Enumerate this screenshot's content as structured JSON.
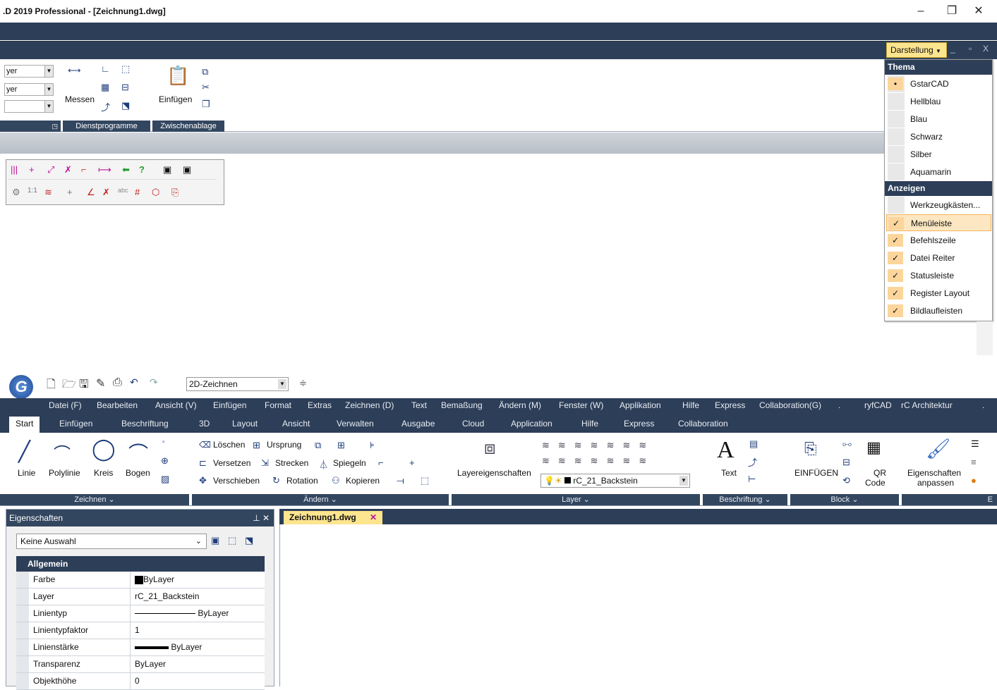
{
  "window": {
    "title": ".D 2019 Professional - [Zeichnung1.dwg]",
    "min": "–",
    "max": "❐",
    "close": "✕"
  },
  "upper_ribbon": {
    "layer_fields": [
      "yer",
      "yer",
      ""
    ],
    "measure_label": "Messen",
    "insert_label": "Einfügen",
    "panels": [
      "Dienstprogramme",
      "Zwischenablage"
    ]
  },
  "darstellung": {
    "button": "Darstellung",
    "ctl": [
      "_",
      "▫",
      "X"
    ]
  },
  "dropdown": {
    "theme_header": "Thema",
    "themes": [
      "GstarCAD",
      "Hellblau",
      "Blau",
      "Schwarz",
      "Silber",
      "Aquamarin"
    ],
    "selected_theme": "GstarCAD",
    "show_header": "Anzeigen",
    "show_items": [
      {
        "label": "Werkzeugkästen...",
        "checked": false
      },
      {
        "label": "Menüleiste",
        "checked": true,
        "highlight": true
      },
      {
        "label": "Befehlszeile",
        "checked": true
      },
      {
        "label": "Datei Reiter",
        "checked": true
      },
      {
        "label": "Statusleiste",
        "checked": true
      },
      {
        "label": "Register Layout",
        "checked": true
      },
      {
        "label": "Bildlaufleisten",
        "checked": true
      }
    ]
  },
  "qat": {
    "workspace": "2D-Zeichnen"
  },
  "menubar": [
    "Datei (F)",
    "Bearbeiten",
    "Ansicht (V)",
    "Einfügen",
    "Format",
    "Extras",
    "Zeichnen (D)",
    "Text",
    "Bemaßung",
    "Ändern (M)",
    "Fenster (W)",
    "Applikation",
    "Hilfe",
    "Express",
    "Collaboration(G)",
    ".",
    "ryfCAD",
    "rC Architektur",
    "."
  ],
  "tabs": [
    "Start",
    "Einfügen",
    "Beschriftung",
    "3D",
    "Layout",
    "Ansicht",
    "Verwalten",
    "Ausgabe",
    "Cloud",
    "Application",
    "Hilfe",
    "Express",
    "Collaboration"
  ],
  "ribbon": {
    "draw": [
      "Linie",
      "Polylinie",
      "Kreis",
      "Bogen"
    ],
    "draw_group": "Zeichnen",
    "modify": [
      "Löschen",
      "Ursprung",
      "Versetzen",
      "Strecken",
      "Spiegeln",
      "Verschieben",
      "Rotation",
      "Kopieren"
    ],
    "modify_group": "Ändern",
    "layer_props": "Layereigenschaften",
    "layer_current": "rC_21_Backstein",
    "layer_group": "Layer",
    "text": "Text",
    "annot_group": "Beschriftung",
    "insert": "EINFÜGEN",
    "qr": "QR",
    "qr2": "Code",
    "block_group": "Block",
    "props_match": "Eigenschaften",
    "props_match2": "anpassen",
    "last_group": "E"
  },
  "properties": {
    "title": "Eigenschaften",
    "pin": "⊥ ✕",
    "selection": "Keine Auswahl",
    "category": "Allgemein",
    "rows": [
      {
        "k": "Farbe",
        "v": "ByLayer"
      },
      {
        "k": "Layer",
        "v": "rC_21_Backstein"
      },
      {
        "k": "Linientyp",
        "v": "ByLayer"
      },
      {
        "k": "Linientypfaktor",
        "v": "1"
      },
      {
        "k": "Linienstärke",
        "v": "ByLayer"
      },
      {
        "k": "Transparenz",
        "v": "ByLayer"
      },
      {
        "k": "Objekthöhe",
        "v": "0"
      }
    ]
  },
  "doc_tab": {
    "label": "Zeichnung1.dwg",
    "close": "✕"
  }
}
